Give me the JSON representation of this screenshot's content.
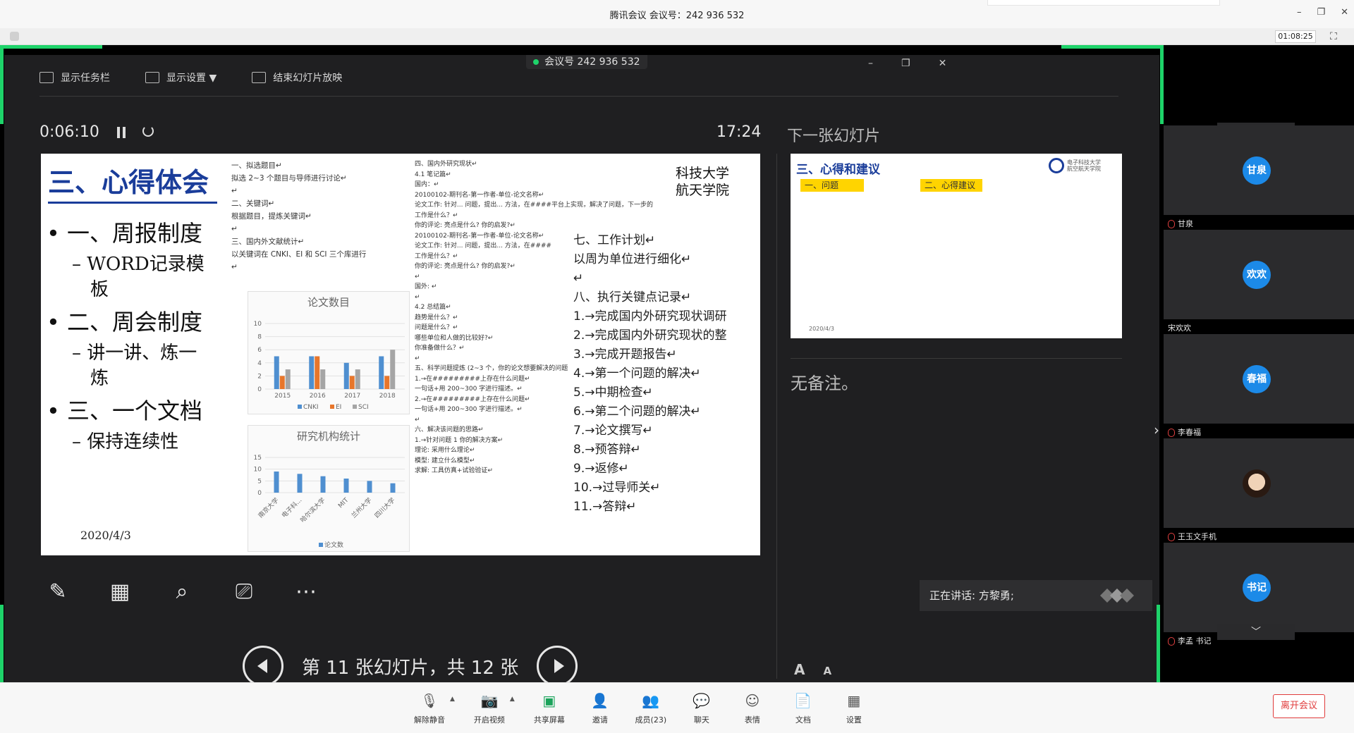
{
  "window": {
    "title": "腾讯会议 会议号：242 936 532",
    "minimize": "–",
    "restore": "❐",
    "close": "✕",
    "meeting_timer": "01:08:25",
    "fullscreen": "⛶"
  },
  "share": {
    "meeting_pill": "会议号 242 936 532",
    "toolbar": [
      {
        "label": "显示任务栏",
        "icon": "taskbar-icon"
      },
      {
        "label": "显示设置 ▼",
        "icon": "display-settings-icon"
      },
      {
        "label": "结束幻灯片放映",
        "icon": "end-slideshow-icon"
      }
    ],
    "controls": {
      "minimize": "–",
      "restore": "❐",
      "close": "✕"
    }
  },
  "presenter": {
    "elapsed": "0:06:10",
    "clock": "17:24",
    "next_title": "下一张幻灯片",
    "notes": "无备注。",
    "slide_status": "第 11 张幻灯片，共 12 张",
    "slide_progress": 0.917,
    "speaking": "正在讲话: 方黎勇;",
    "font_increase": "A",
    "font_decrease": "A",
    "tools": [
      "pen-icon",
      "slides-grid-icon",
      "zoom-icon",
      "pointer-screen-icon",
      "more-icon"
    ]
  },
  "current_slide": {
    "title": "三、心得体会",
    "bullets": [
      {
        "level": 1,
        "text": "• 一、周报制度"
      },
      {
        "level": 2,
        "text": "– WORD记录模"
      },
      {
        "level": 2,
        "text": "板"
      },
      {
        "level": 1,
        "text": "• 二、周会制度"
      },
      {
        "level": 2,
        "text": "– 讲一讲、炼一"
      },
      {
        "level": 2,
        "text": "炼"
      },
      {
        "level": 1,
        "text": "• 三、一个文档"
      },
      {
        "level": 2,
        "text": "– 保持连续性"
      }
    ],
    "date": "2020/4/3",
    "university": [
      "科技大学",
      "航天学院"
    ],
    "doc_col1": [
      "一、拟选题目↵",
      "拟选 2~3 个题目与导师进行讨论↵",
      "↵",
      "二、关键词↵",
      "根据题目，提炼关键词↵",
      "↵",
      "三、国内外文献统计↵",
      "以关键词在 CNKI、EI 和 SCI 三个库进行",
      "↵"
    ],
    "doc_col2": [
      "四、国内外研究现状↵",
      "4.1 笔记篇↵",
      "国内：↵",
      "20100102-期刊名-第一作者-单位-论文名称↵",
      "论文工作: 针对... 问题，提出... 方法，在####平台上实现，解决了问题，下一步的",
      "工作是什么？↵",
      "你的评论: 亮点是什么? 你的启发?↵",
      "20100102-期刊名-第一作者-单位-论文名称↵",
      "论文工作: 针对... 问题，提出... 方法，在####",
      "工作是什么？↵",
      "你的评论: 亮点是什么? 你的启发?↵",
      "↵",
      "国外: ↵",
      "↵",
      "4.2 总结篇↵",
      "趋势是什么？↵",
      "问题是什么？↵",
      "哪些单位和人做的比较好?↵",
      "你准备做什么？↵",
      "↵",
      "五、科学问题提炼 (2~3 个，你的论文想要解决的问题",
      "1.→在#########上存在什么问题↵",
      "一句话+用 200~300 字进行描述。↵",
      "2.→在#########上存在什么问题↵",
      "一句话+用 200~300 字进行描述。↵",
      "↵",
      "六、解决该问题的思路↵",
      "1.→针对问题 1 你的解决方案↵",
      "理论: 采用什么理论↵",
      "模型: 建立什么模型↵",
      "求解: 工具仿真+试验验证↵"
    ],
    "doc_col3": [
      "七、工作计划↵",
      "以周为单位进行细化↵",
      "↵",
      "八、执行关键点记录↵",
      "1.→完成国内外研究现状调研",
      "2.→完成国内外研究现状的整",
      "3.→完成开题报告↵",
      "4.→第一个问题的解决↵",
      "5.→中期检查↵",
      "6.→第二个问题的解决↵",
      "7.→论文撰写↵",
      "8.→预答辩↵",
      "9.→返修↵",
      "10.→过导师关↵",
      "11.→答辩↵"
    ]
  },
  "chart_data": [
    {
      "type": "bar",
      "title": "论文数目",
      "categories": [
        "2015",
        "2016",
        "2017",
        "2018"
      ],
      "ylim": [
        0,
        10
      ],
      "yticks": [
        "0",
        "2",
        "4",
        "6",
        "8",
        "10"
      ],
      "legend": "bottom",
      "series": [
        {
          "name": "CNKI",
          "color": "#4f8fd0",
          "values": [
            5,
            5,
            4,
            5
          ]
        },
        {
          "name": "EI",
          "color": "#e8762b",
          "values": [
            2,
            5,
            2,
            2
          ]
        },
        {
          "name": "SCI",
          "color": "#a5a5a5",
          "values": [
            3,
            3,
            3,
            6
          ]
        }
      ]
    },
    {
      "type": "bar",
      "title": "研究机构统计",
      "categories": [
        "南京大学",
        "电子科...",
        "哈尔滨大学",
        "MIT",
        "兰州大学",
        "四川大学"
      ],
      "ylim": [
        0,
        15
      ],
      "yticks": [
        "0",
        "5",
        "10",
        "15"
      ],
      "legend": "bottom",
      "series": [
        {
          "name": "论文数",
          "color": "#4f8fd0",
          "values": [
            9,
            8,
            7,
            6,
            5,
            4
          ]
        }
      ]
    }
  ],
  "next_slide": {
    "title": "三、心得和建议",
    "tag1": "一、问题",
    "tag2": "二、心得建议",
    "logo_text": [
      "电子科技大学",
      "航空航天学院"
    ],
    "date": "2020/4/3"
  },
  "participants": [
    {
      "avatar": "甘泉",
      "name": "甘泉",
      "muted": true
    },
    {
      "avatar": "欢欢",
      "name": "宋欢欢",
      "muted": false
    },
    {
      "avatar": "春福",
      "name": "李春福",
      "muted": true
    },
    {
      "avatar": "",
      "name": "王玉文手机",
      "muted": true,
      "photo": true
    },
    {
      "avatar": "书记",
      "name": "李孟 书记",
      "muted": true
    }
  ],
  "panel": {
    "scroll_up": "︿",
    "scroll_down": "﹀",
    "expand": "›"
  },
  "bottombar": {
    "items": [
      {
        "label": "解除静音",
        "icon": "mic-muted-icon",
        "caret": true
      },
      {
        "label": "开启视频",
        "icon": "video-off-icon",
        "caret": true
      },
      {
        "label": "共享屏幕",
        "icon": "share-screen-icon",
        "caret": false
      },
      {
        "label": "邀请",
        "icon": "invite-icon",
        "caret": false
      },
      {
        "label": "成员(23)",
        "icon": "members-icon",
        "caret": false
      },
      {
        "label": "聊天",
        "icon": "chat-icon",
        "caret": false
      },
      {
        "label": "表情",
        "icon": "emoji-icon",
        "caret": false
      },
      {
        "label": "文档",
        "icon": "document-icon",
        "caret": false
      },
      {
        "label": "设置",
        "icon": "settings-icon",
        "caret": false
      }
    ],
    "leave": "离开会议",
    "caret": "▲"
  }
}
